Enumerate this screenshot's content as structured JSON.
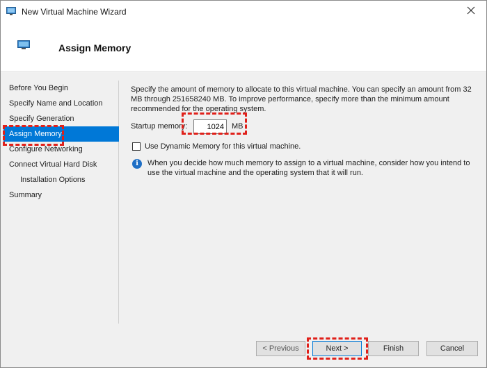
{
  "window": {
    "title": "New Virtual Machine Wizard",
    "icon": "vm-wizard-icon"
  },
  "header": {
    "title": "Assign Memory",
    "icon": "monitor-icon"
  },
  "nav": {
    "items": [
      {
        "label": "Before You Begin",
        "active": false,
        "indent": false
      },
      {
        "label": "Specify Name and Location",
        "active": false,
        "indent": false
      },
      {
        "label": "Specify Generation",
        "active": false,
        "indent": false
      },
      {
        "label": "Assign Memory",
        "active": true,
        "indent": false
      },
      {
        "label": "Configure Networking",
        "active": false,
        "indent": false
      },
      {
        "label": "Connect Virtual Hard Disk",
        "active": false,
        "indent": false
      },
      {
        "label": "Installation Options",
        "active": false,
        "indent": true
      },
      {
        "label": "Summary",
        "active": false,
        "indent": false
      }
    ]
  },
  "main": {
    "description": "Specify the amount of memory to allocate to this virtual machine. You can specify an amount from 32 MB through 251658240 MB. To improve performance, specify more than the minimum amount recommended for the operating system.",
    "startup_memory_label": "Startup memory:",
    "startup_memory_value": "1024",
    "startup_memory_unit": "MB",
    "dynamic_memory_label": "Use Dynamic Memory for this virtual machine.",
    "dynamic_memory_checked": false,
    "info_text": "When you decide how much memory to assign to a virtual machine, consider how you intend to use the virtual machine and the operating system that it will run."
  },
  "footer": {
    "previous_label": "< Previous",
    "next_label": "Next >",
    "finish_label": "Finish",
    "cancel_label": "Cancel"
  },
  "colors": {
    "accent": "#0078d7",
    "highlight": "#e0201a",
    "panel_bg": "#f0f0f0"
  }
}
